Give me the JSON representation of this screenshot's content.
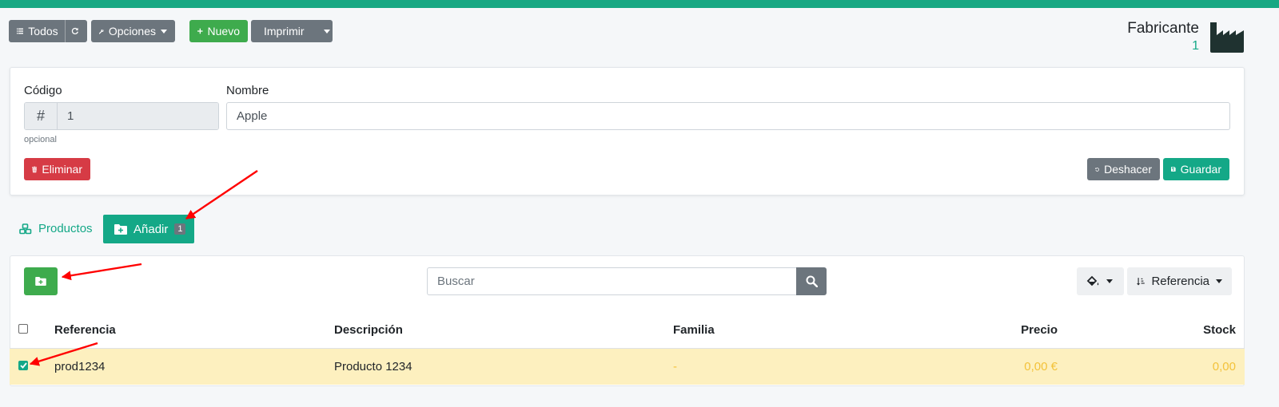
{
  "toolbar": {
    "todos_label": "Todos",
    "opciones_label": "Opciones",
    "nuevo_label": "Nuevo",
    "imprimir_label": "Imprimir"
  },
  "header": {
    "title": "Fabricante",
    "count": "1",
    "icon": "factory-icon"
  },
  "form": {
    "codigo_label": "Código",
    "codigo_prefix": "#",
    "codigo_value": "1",
    "codigo_help": "opcional",
    "nombre_label": "Nombre",
    "nombre_value": "Apple",
    "eliminar_label": "Eliminar",
    "deshacer_label": "Deshacer",
    "guardar_label": "Guardar"
  },
  "tabs": {
    "productos_label": "Productos",
    "anadir_label": "Añadir",
    "anadir_badge": "1"
  },
  "list": {
    "search_placeholder": "Buscar",
    "sort_label": "Referencia",
    "columns": [
      "Referencia",
      "Descripción",
      "Familia",
      "Precio",
      "Stock"
    ],
    "rows": [
      {
        "referencia": "prod1234",
        "descripcion": "Producto 1234",
        "familia": "-",
        "precio": "0,00 €",
        "stock": "0,00",
        "checked": true
      }
    ]
  },
  "colors": {
    "accent": "#14a887",
    "success": "#3eab4d",
    "danger": "#d63b45",
    "secondary": "#6c757d",
    "row_highlight": "#fdf0bf",
    "annotation": "#ff0000"
  }
}
